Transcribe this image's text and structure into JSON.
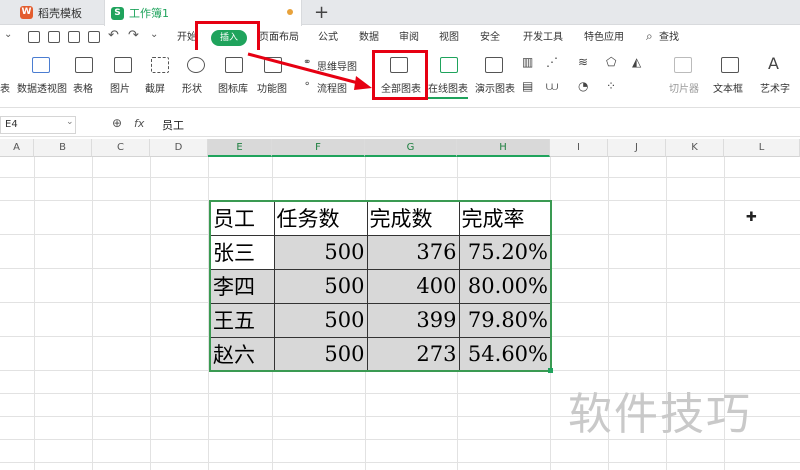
{
  "tabs": [
    {
      "label": "稻壳模板"
    },
    {
      "label": "工作簿1"
    }
  ],
  "menu": {
    "items": [
      "开始",
      "插入",
      "页面布局",
      "公式",
      "数据",
      "审阅",
      "视图",
      "安全",
      "开发工具",
      "特色应用",
      "查找"
    ],
    "active": "插入"
  },
  "ribbon": {
    "items": [
      "表",
      "数据透视图",
      "表格",
      "图片",
      "截屏",
      "形状",
      "图标库",
      "功能图",
      "思维导图",
      "流程图",
      "全部图表",
      "在线图表",
      "演示图表",
      "切片器",
      "文本框",
      "艺术字"
    ]
  },
  "formula_bar": {
    "cell_ref": "E4",
    "fx": "fx",
    "content": "员工"
  },
  "columns": [
    "A",
    "B",
    "C",
    "D",
    "E",
    "F",
    "G",
    "H",
    "I",
    "J",
    "K",
    "L"
  ],
  "table": {
    "headers": [
      "员工",
      "任务数",
      "完成数",
      "完成率"
    ],
    "rows": [
      [
        "张三",
        "500",
        "376",
        "75.20%"
      ],
      [
        "李四",
        "500",
        "400",
        "80.00%"
      ],
      [
        "王五",
        "500",
        "399",
        "79.80%"
      ],
      [
        "赵六",
        "500",
        "273",
        "54.60%"
      ]
    ]
  },
  "watermark": "软件技巧",
  "colors": {
    "accent": "#1fa35c",
    "highlight": "#e60012"
  }
}
